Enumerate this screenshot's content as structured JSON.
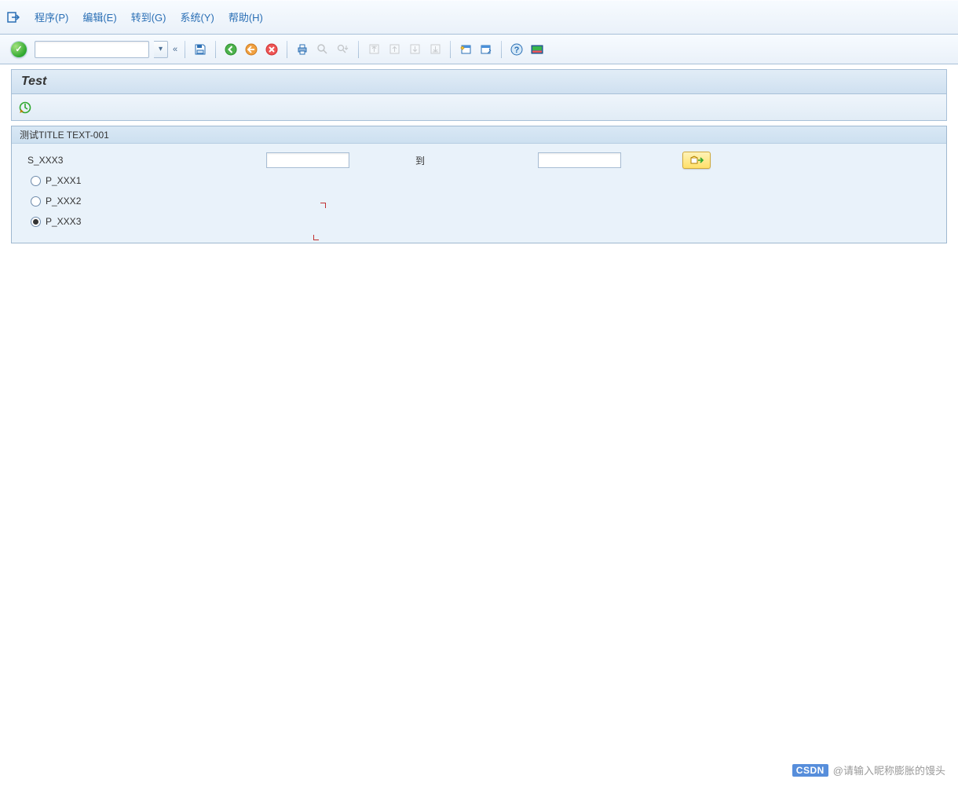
{
  "menu": {
    "program": "程序(P)",
    "edit": "编辑(E)",
    "goto": "转到(G)",
    "system": "系统(Y)",
    "help": "帮助(H)"
  },
  "toolbar": {
    "command_value": ""
  },
  "title": "Test",
  "selection": {
    "frame_title": "测试TITLE TEXT-001",
    "s_field_label": "S_XXX3",
    "s_field_from": "",
    "to_label": "到",
    "s_field_to": "",
    "radios": [
      {
        "label": "P_XXX1",
        "checked": false
      },
      {
        "label": "P_XXX2",
        "checked": false
      },
      {
        "label": "P_XXX3",
        "checked": true
      }
    ]
  },
  "watermark": {
    "logo": "CSDN",
    "text": "@请输入昵称膨胀的馒头"
  }
}
